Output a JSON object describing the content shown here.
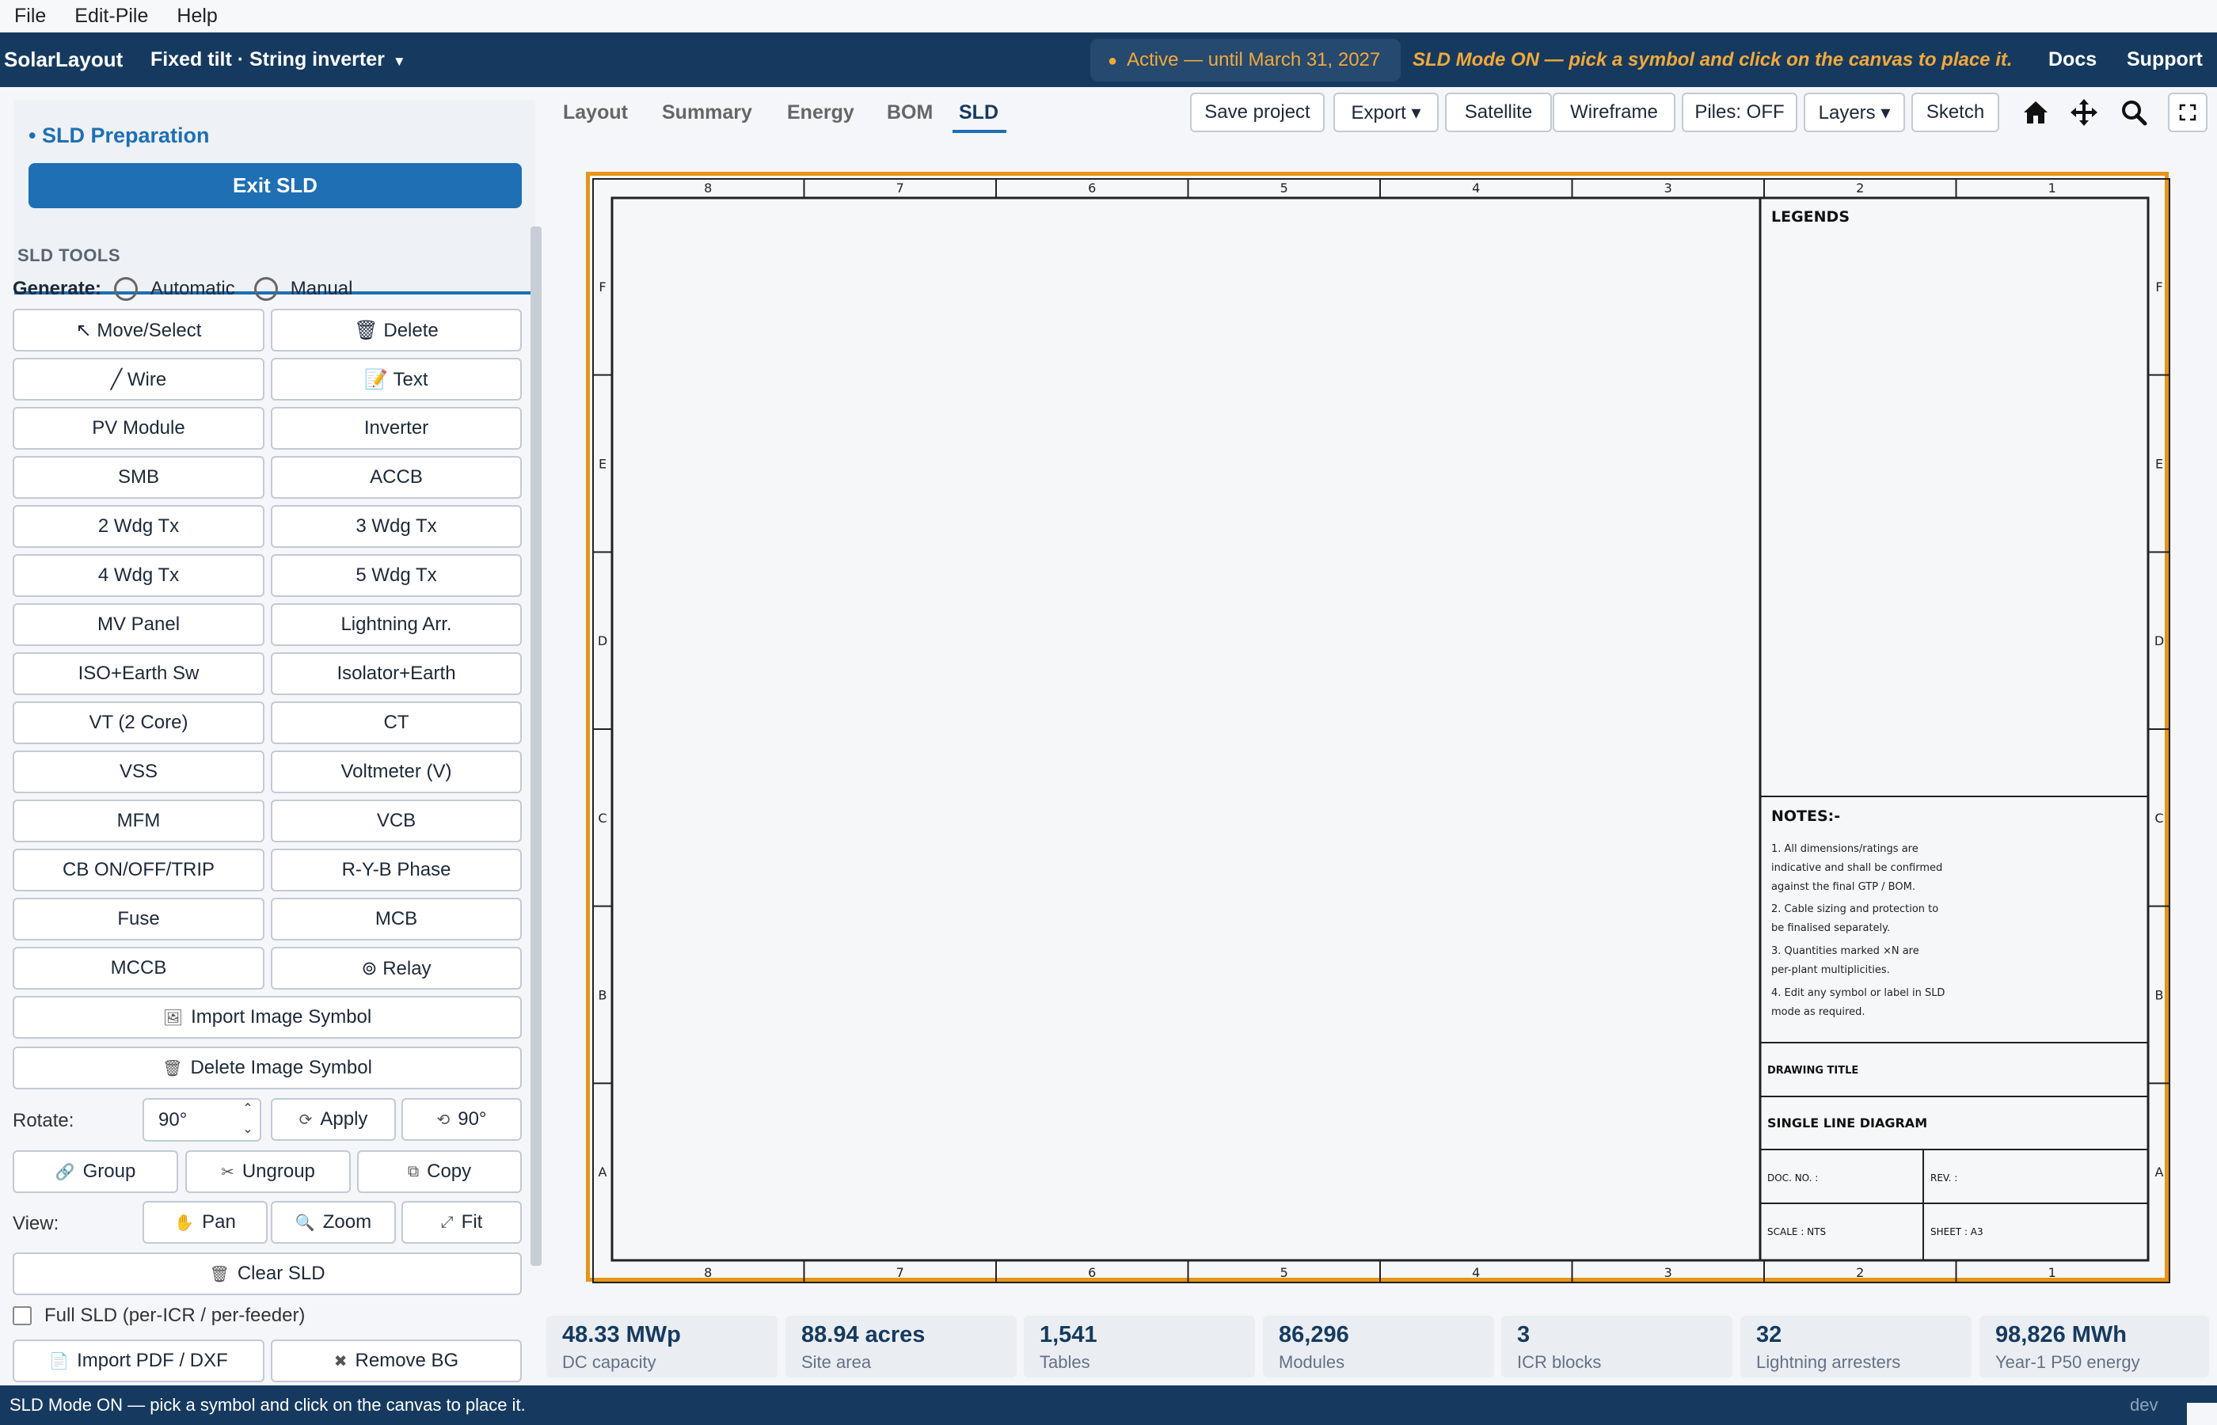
{
  "menu": {
    "file": "File",
    "edit": "Edit-Pile",
    "help": "Help"
  },
  "header": {
    "brand": "SolarLayout",
    "project": "Fixed tilt · String inverter",
    "license": "Active — until March 31, 2027",
    "sld_message": "SLD Mode ON — pick a symbol and click on the canvas to place it.",
    "docs": "Docs",
    "support": "Support"
  },
  "panel": {
    "section_title": "SLD Preparation",
    "exit_label": "Exit SLD",
    "tools_title": "SLD TOOLS",
    "generate_label": "Generate:",
    "generate_auto": "Automatic",
    "generate_manual": "Manual",
    "tools": [
      [
        "↖ Move/Select",
        "🗑 Delete"
      ],
      [
        "╱ Wire",
        "📝 Text"
      ],
      [
        "PV Module",
        "Inverter"
      ],
      [
        "SMB",
        "ACCB"
      ],
      [
        "2 Wdg Tx",
        "3 Wdg Tx"
      ],
      [
        "4 Wdg Tx",
        "5 Wdg Tx"
      ],
      [
        "MV Panel",
        "Lightning Arr."
      ],
      [
        "ISO+Earth Sw",
        "Isolator+Earth"
      ],
      [
        "VT (2 Core)",
        "CT"
      ],
      [
        "VSS",
        "Voltmeter (V)"
      ],
      [
        "MFM",
        "VCB"
      ],
      [
        "CB ON/OFF/TRIP",
        "R-Y-B Phase"
      ],
      [
        "Fuse",
        "MCB"
      ],
      [
        "MCCB",
        "⊚ Relay"
      ]
    ],
    "import_image": "Import Image Symbol",
    "delete_image": "Delete Image Symbol",
    "rotate_label": "Rotate:",
    "rotate_value": "90°",
    "apply": "Apply",
    "rotate_ccw": "90°",
    "group": "Group",
    "ungroup": "Ungroup",
    "copy": "Copy",
    "view_label": "View:",
    "pan": "Pan",
    "zoom": "Zoom",
    "fit": "Fit",
    "clear": "Clear SLD",
    "full_sld": "Full SLD (per-ICR / per-feeder)",
    "import_pdf": "Import PDF / DXF",
    "remove_bg": "Remove BG"
  },
  "tabs": {
    "layout": "Layout",
    "summary": "Summary",
    "energy": "Energy",
    "bom": "BOM",
    "sld": "SLD"
  },
  "toolbar": {
    "save": "Save project",
    "export": "Export ▾",
    "satellite": "Satellite",
    "wireframe": "Wireframe",
    "piles": "Piles: OFF",
    "layers": "Layers ▾",
    "sketch": "Sketch"
  },
  "sheet": {
    "col_labels": [
      "8",
      "7",
      "6",
      "5",
      "4",
      "3",
      "2",
      "1"
    ],
    "row_labels": [
      "F",
      "E",
      "D",
      "C",
      "B",
      "A"
    ],
    "legends": "LEGENDS",
    "notes_title": "NOTES:-",
    "notes": [
      "1. All dimensions/ratings are",
      "indicative and shall be confirmed",
      "against the final GTP / BOM.",
      "2. Cable sizing and protection to",
      "be finalised separately.",
      "3. Quantities marked ×N are",
      "per-plant multiplicities.",
      "4. Edit any symbol or label in SLD",
      "mode as required."
    ],
    "drawing_title_label": "DRAWING TITLE",
    "drawing_title": "SINGLE LINE DIAGRAM",
    "doc_no": "DOC. NO. :",
    "rev": "REV. :",
    "scale": "SCALE : NTS",
    "sheet": "SHEET : A3"
  },
  "stats": [
    {
      "value": "48.33 MWp",
      "label": "DC capacity"
    },
    {
      "value": "88.94 acres",
      "label": "Site area"
    },
    {
      "value": "1,541",
      "label": "Tables"
    },
    {
      "value": "86,296",
      "label": "Modules"
    },
    {
      "value": "3",
      "label": "ICR blocks"
    },
    {
      "value": "32",
      "label": "Lightning arresters"
    },
    {
      "value": "98,826 MWh",
      "label": "Year-1 P50 energy"
    }
  ],
  "status": {
    "message": "SLD Mode ON — pick a symbol and click on the canvas to place it.",
    "env": "dev"
  },
  "colors": {
    "brand": "#163a5f",
    "accent": "#1e6fb3",
    "highlight": "#e69519"
  }
}
